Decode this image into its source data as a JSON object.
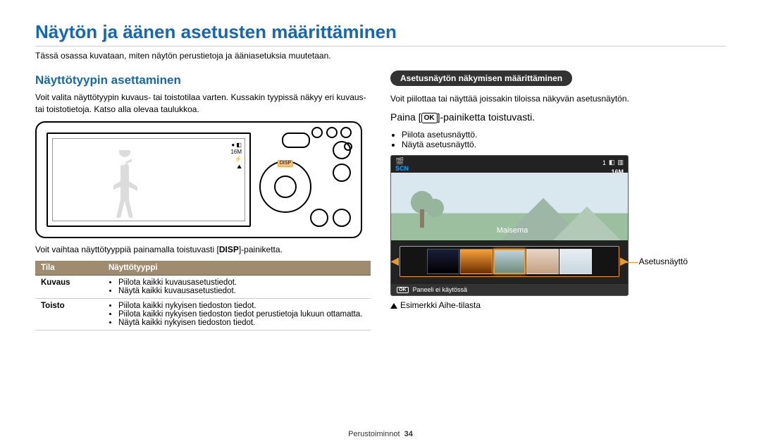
{
  "title": "Näytön ja äänen asetusten määrittäminen",
  "intro": "Tässä osassa kuvataan, miten näytön perustietoja ja ääniasetuksia muutetaan.",
  "left": {
    "heading": "Näyttötyypin asettaminen",
    "para1": "Voit valita näyttötyypin kuvaus- tai toistotilaa varten. Kussakin tyypissä näkyy eri kuvaus- tai toistotietoja. Katso alla olevaa taulukkoa.",
    "para2_pre": "Voit vaihtaa näyttötyyppiä painamalla toistuvasti [",
    "para2_key": "DISP",
    "para2_post": "]-painiketta.",
    "disp_label": "DISP",
    "screen_status": "16M",
    "table": {
      "head": {
        "mode": "Tila",
        "type": "Näyttötyyppi"
      },
      "rows": [
        {
          "mode": "Kuvaus",
          "items": [
            "Piilota kaikki kuvausasetustiedot.",
            "Näytä kaikki kuvausasetustiedot."
          ]
        },
        {
          "mode": "Toisto",
          "items": [
            "Piilota kaikki nykyisen tiedoston tiedot.",
            "Piilota kaikki nykyisen tiedoston tiedot perustietoja lukuun ottamatta.",
            "Näytä kaikki nykyisen tiedoston tiedot."
          ]
        }
      ]
    }
  },
  "right": {
    "pill": "Asetusnäytön näkymisen määrittäminen",
    "para1": "Voit piilottaa tai näyttää joissakin tiloissa näkyvän asetusnäytön.",
    "press_pre": "Paina [",
    "press_key": "OK",
    "press_post": "]-painiketta toistuvasti.",
    "bullets": [
      "Piilota asetusnäyttö.",
      "Näytä asetusnäyttö."
    ],
    "lcd": {
      "scn_label": "SCN",
      "top_num": "1",
      "top_res": "16M",
      "scene_label": "Maisema",
      "ok_label": "OK",
      "bottom_text": "Paneeli ei käytössä"
    },
    "callout": "Asetusnäyttö",
    "footnote": "Esimerkki Aihe-tilasta"
  },
  "footer": {
    "section": "Perustoiminnot",
    "page": "34"
  }
}
